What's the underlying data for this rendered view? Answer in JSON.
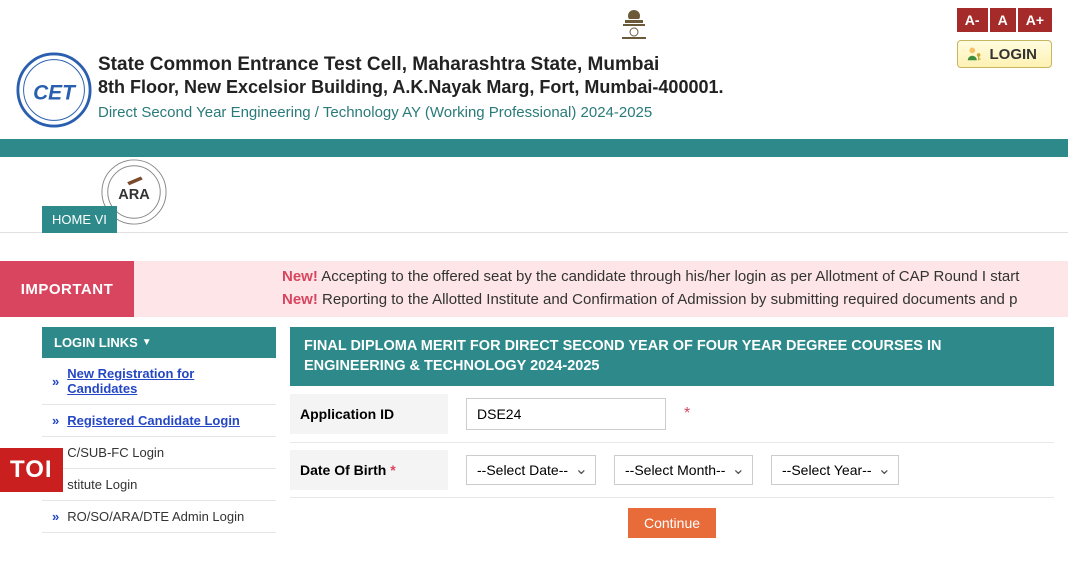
{
  "fontControls": {
    "dec": "A-",
    "norm": "A",
    "inc": "A+"
  },
  "login": {
    "label": "LOGIN"
  },
  "header": {
    "orgName": "State Common Entrance Test Cell, Maharashtra State, Mumbai",
    "orgAddr": "8th Floor, New Excelsior Building, A.K.Nayak Marg, Fort, Mumbai-400001.",
    "subtitle": "Direct Second Year Engineering / Technology AY (Working Professional) 2024-2025"
  },
  "nav": {
    "home": "HOME VI"
  },
  "important": {
    "label": "IMPORTANT",
    "newTag": "New!",
    "line1": "Accepting to the offered seat by the candidate through his/her login as per Allotment of CAP Round I start",
    "line2": "Reporting to the Allotted Institute and Confirmation of Admission by submitting required documents and p"
  },
  "sidebar": {
    "header": "LOGIN LINKS",
    "items": [
      {
        "label": "New Registration for Candidates",
        "bold": true
      },
      {
        "label": "Registered Candidate Login",
        "bold": true
      },
      {
        "label": "C/SUB-FC Login",
        "bold": false
      },
      {
        "label": "stitute Login",
        "bold": false
      },
      {
        "label": "RO/SO/ARA/DTE Admin Login",
        "bold": false
      }
    ]
  },
  "panel": {
    "title": "FINAL DIPLOMA MERIT FOR DIRECT SECOND YEAR OF FOUR YEAR DEGREE COURSES IN ENGINEERING & TECHNOLOGY 2024-2025",
    "appIdLabel": "Application ID",
    "appIdValue": "DSE24",
    "dobLabel": "Date Of Birth",
    "selDate": "--Select Date--",
    "selMonth": "--Select Month--",
    "selYear": "--Select Year--",
    "continue": "Continue"
  },
  "toi": "TOI"
}
